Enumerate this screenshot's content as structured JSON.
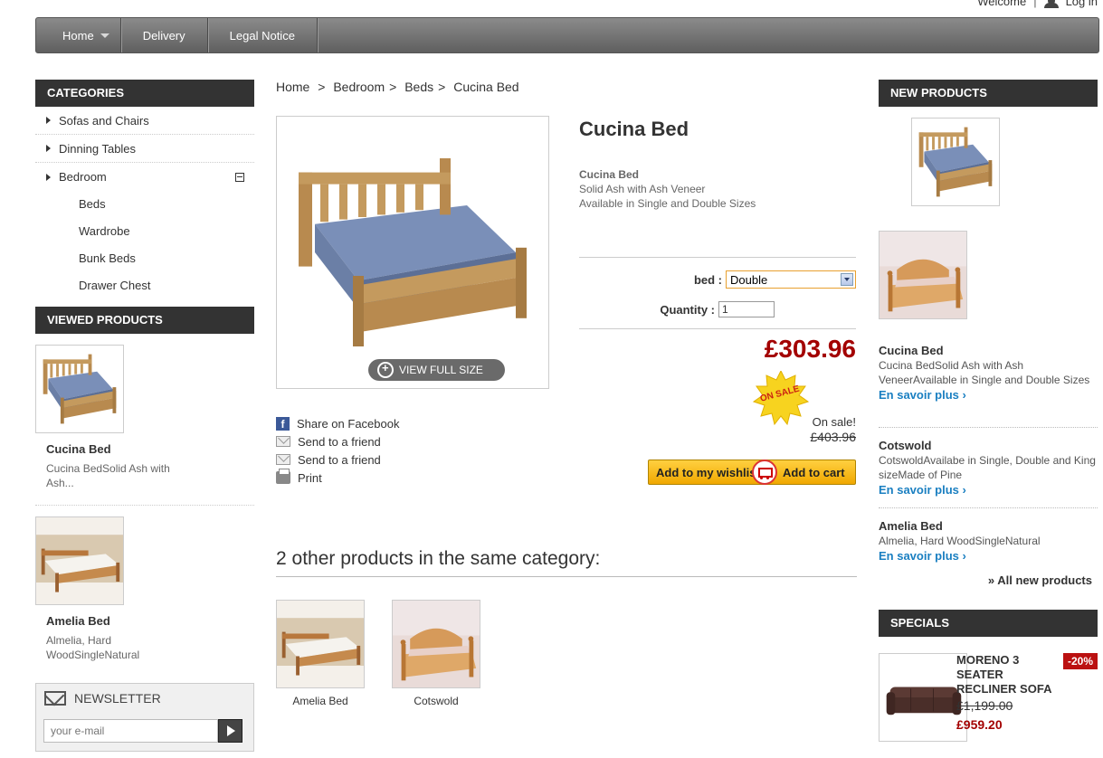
{
  "topbar": {
    "welcome": "Welcome",
    "separator": "|",
    "login": "Log in"
  },
  "nav": {
    "items": [
      {
        "label": "Home"
      },
      {
        "label": "Delivery"
      },
      {
        "label": "Legal Notice"
      }
    ]
  },
  "categories": {
    "title": "CATEGORIES",
    "items": [
      {
        "label": "Sofas and Chairs"
      },
      {
        "label": "Dinning Tables"
      },
      {
        "label": "Bedroom"
      }
    ],
    "subitems": [
      {
        "label": "Beds"
      },
      {
        "label": "Wardrobe"
      },
      {
        "label": "Bunk Beds"
      },
      {
        "label": "Drawer Chest"
      }
    ]
  },
  "viewed": {
    "title": "VIEWED PRODUCTS",
    "items": [
      {
        "name": "Cucina Bed",
        "desc": "Cucina BedSolid Ash with Ash..."
      },
      {
        "name": "Amelia Bed",
        "desc": "Almelia, Hard WoodSingleNatural"
      }
    ]
  },
  "newsletter": {
    "title": "NEWSLETTER",
    "placeholder": "your e-mail"
  },
  "breadcrumb": {
    "home": "Home",
    "sep1": ">",
    "bedroom": "Bedroom",
    "sep2": ">",
    "beds": "Beds",
    "sep3": ">",
    "current": "Cucina Bed"
  },
  "product": {
    "view_full": "VIEW FULL SIZE",
    "title": "Cucina Bed",
    "desc_title": "Cucina Bed",
    "desc_line1": "Solid Ash with Ash Veneer",
    "desc_line2": "Available in Single and Double Sizes",
    "option_label": "bed :",
    "option_value": "Double",
    "qty_label": "Quantity :",
    "qty_value": "1",
    "price": "£303.96",
    "sale_badge": "ON SALE",
    "on_sale": "On sale!",
    "old_price": "£403.96",
    "wishlist": "Add to my wishlist",
    "add_to_cart": "Add to cart"
  },
  "share": {
    "facebook": "Share on Facebook",
    "friend1": "Send to a friend",
    "friend2": "Send to a friend",
    "print": "Print"
  },
  "other": {
    "title": "2 other products in the same category:",
    "items": [
      {
        "name": "Amelia Bed"
      },
      {
        "name": "Cotswold"
      }
    ]
  },
  "new_products": {
    "title": "NEW PRODUCTS",
    "items": [
      {
        "name": "Cucina Bed",
        "desc": "Cucina BedSolid Ash with Ash VeneerAvailable in Single and Double Sizes",
        "more": "En savoir plus"
      },
      {
        "name": "Cotswold",
        "desc": "CotswoldAvailabe in Single, Double and King sizeMade of Pine",
        "more": "En savoir plus"
      },
      {
        "name": "Amelia Bed",
        "desc": "Almelia, Hard WoodSingleNatural",
        "more": "En savoir plus"
      }
    ],
    "all_link": "» All new products"
  },
  "specials": {
    "title": "SPECIALS",
    "name": "MORENO 3 SEATER RECLINER SOFA",
    "discount": "-20%",
    "old_price": "£1,199.00",
    "new_price": "£959.20"
  },
  "colors": {
    "price_red": "#a30000",
    "link_blue": "#1a7fc1",
    "header_dark": "#333333",
    "cart_yellow": "#f0a800"
  }
}
